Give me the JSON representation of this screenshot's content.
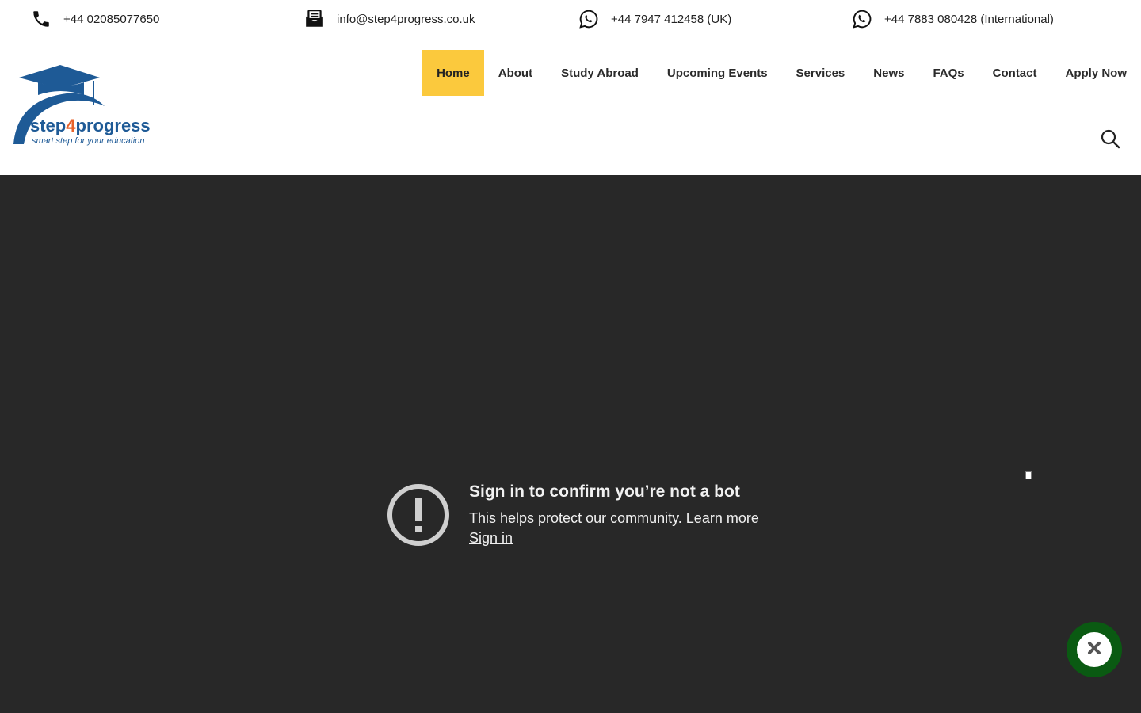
{
  "topbar": {
    "phone": "+44 02085077650",
    "email": "info@step4progress.co.uk",
    "whatsapp_uk": "+44 7947 412458 (UK)",
    "whatsapp_intl": "+44 7883 080428 (International)"
  },
  "logo": {
    "brand_a": "step",
    "brand_b": "4",
    "brand_c": "progress",
    "tagline": "smart step for your education"
  },
  "nav": {
    "items": [
      "Home",
      "About",
      "Study Abroad",
      "Upcoming Events",
      "Services",
      "News",
      "FAQs",
      "Contact",
      "Apply Now"
    ],
    "active": "Home"
  },
  "embed": {
    "title": "Sign in to confirm you’re not a bot",
    "subtitle": "This helps protect our community.",
    "learn_more": "Learn more",
    "sign_in": "Sign in"
  },
  "colors": {
    "accent": "#fbc93d",
    "brand_blue": "#1e5a96",
    "brand_orange": "#e8632b",
    "embed_bg": "#282828",
    "fab": "#0a5a12"
  }
}
